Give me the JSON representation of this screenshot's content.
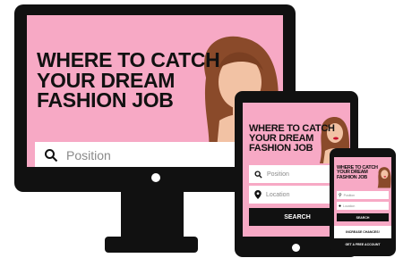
{
  "hero": {
    "headline_line1": "WHERE TO CATCH",
    "headline_line2": "YOUR DREAM",
    "headline_line3": "FASHION JOB"
  },
  "search": {
    "position_placeholder": "Position",
    "location_placeholder": "Location",
    "button_label": "SEARCH"
  },
  "phone": {
    "tagline": "INCREASE CHANCES!",
    "cta_label": "GET A FREE ACCOUNT"
  },
  "colors": {
    "brand_pink": "#f7a9c5",
    "device_frame": "#111111"
  }
}
